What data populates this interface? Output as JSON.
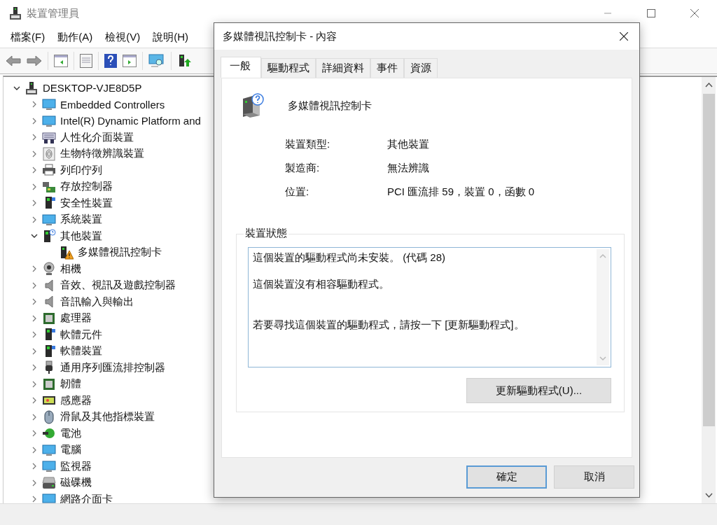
{
  "window": {
    "title": "裝置管理員"
  },
  "menu": [
    "檔案(F)",
    "動作(A)",
    "檢視(V)",
    "說明(H)"
  ],
  "tree": {
    "label": "DESKTOP-VJE8D5P",
    "expanded": true,
    "children": [
      {
        "label": "Embedded Controllers",
        "expanded": false
      },
      {
        "label": "Intel(R) Dynamic Platform and",
        "expanded": false
      },
      {
        "label": "人性化介面裝置",
        "expanded": false
      },
      {
        "label": "生物特徵辨識裝置",
        "expanded": false
      },
      {
        "label": "列印佇列",
        "expanded": false
      },
      {
        "label": "存放控制器",
        "expanded": false
      },
      {
        "label": "安全性裝置",
        "expanded": false
      },
      {
        "label": "系統裝置",
        "expanded": false
      },
      {
        "label": "其他裝置",
        "expanded": true,
        "children": [
          {
            "label": "多媒體視訊控制卡"
          }
        ]
      },
      {
        "label": "相機",
        "expanded": false
      },
      {
        "label": "音效、視訊及遊戲控制器",
        "expanded": false
      },
      {
        "label": "音訊輸入與輸出",
        "expanded": false
      },
      {
        "label": "處理器",
        "expanded": false
      },
      {
        "label": "軟體元件",
        "expanded": false
      },
      {
        "label": "軟體裝置",
        "expanded": false
      },
      {
        "label": "通用序列匯流排控制器",
        "expanded": false
      },
      {
        "label": "韌體",
        "expanded": false
      },
      {
        "label": "感應器",
        "expanded": false
      },
      {
        "label": "滑鼠及其他指標裝置",
        "expanded": false
      },
      {
        "label": "電池",
        "expanded": false
      },
      {
        "label": "電腦",
        "expanded": false
      },
      {
        "label": "監視器",
        "expanded": false
      },
      {
        "label": "磁碟機",
        "expanded": false
      },
      {
        "label": "網路介面卡",
        "expanded": false
      }
    ]
  },
  "dialog": {
    "title": "多媒體視訊控制卡 - 內容",
    "tabs": [
      {
        "label": "一般",
        "selected": true
      },
      {
        "label": "驅動程式",
        "selected": false
      },
      {
        "label": "詳細資料",
        "selected": false
      },
      {
        "label": "事件",
        "selected": false
      },
      {
        "label": "資源",
        "selected": false
      }
    ],
    "device_name": "多媒體視訊控制卡",
    "properties": [
      {
        "label": "裝置類型:",
        "value": "其他裝置"
      },
      {
        "label": "製造商:",
        "value": "無法辨識"
      },
      {
        "label": "位置:",
        "value": "PCI 匯流排 59，裝置 0，函數 0"
      }
    ],
    "status_group": "裝置狀態",
    "status_lines": [
      "這個裝置的驅動程式尚未安裝。 (代碼 28)",
      "這個裝置沒有相容驅動程式。",
      "若要尋找這個裝置的驅動程式，請按一下 [更新驅動程式]。"
    ],
    "update_button": "更新驅動程式(U)...",
    "buttons": [
      {
        "label": "確定",
        "default": true
      },
      {
        "label": "取消",
        "default": false
      }
    ]
  }
}
